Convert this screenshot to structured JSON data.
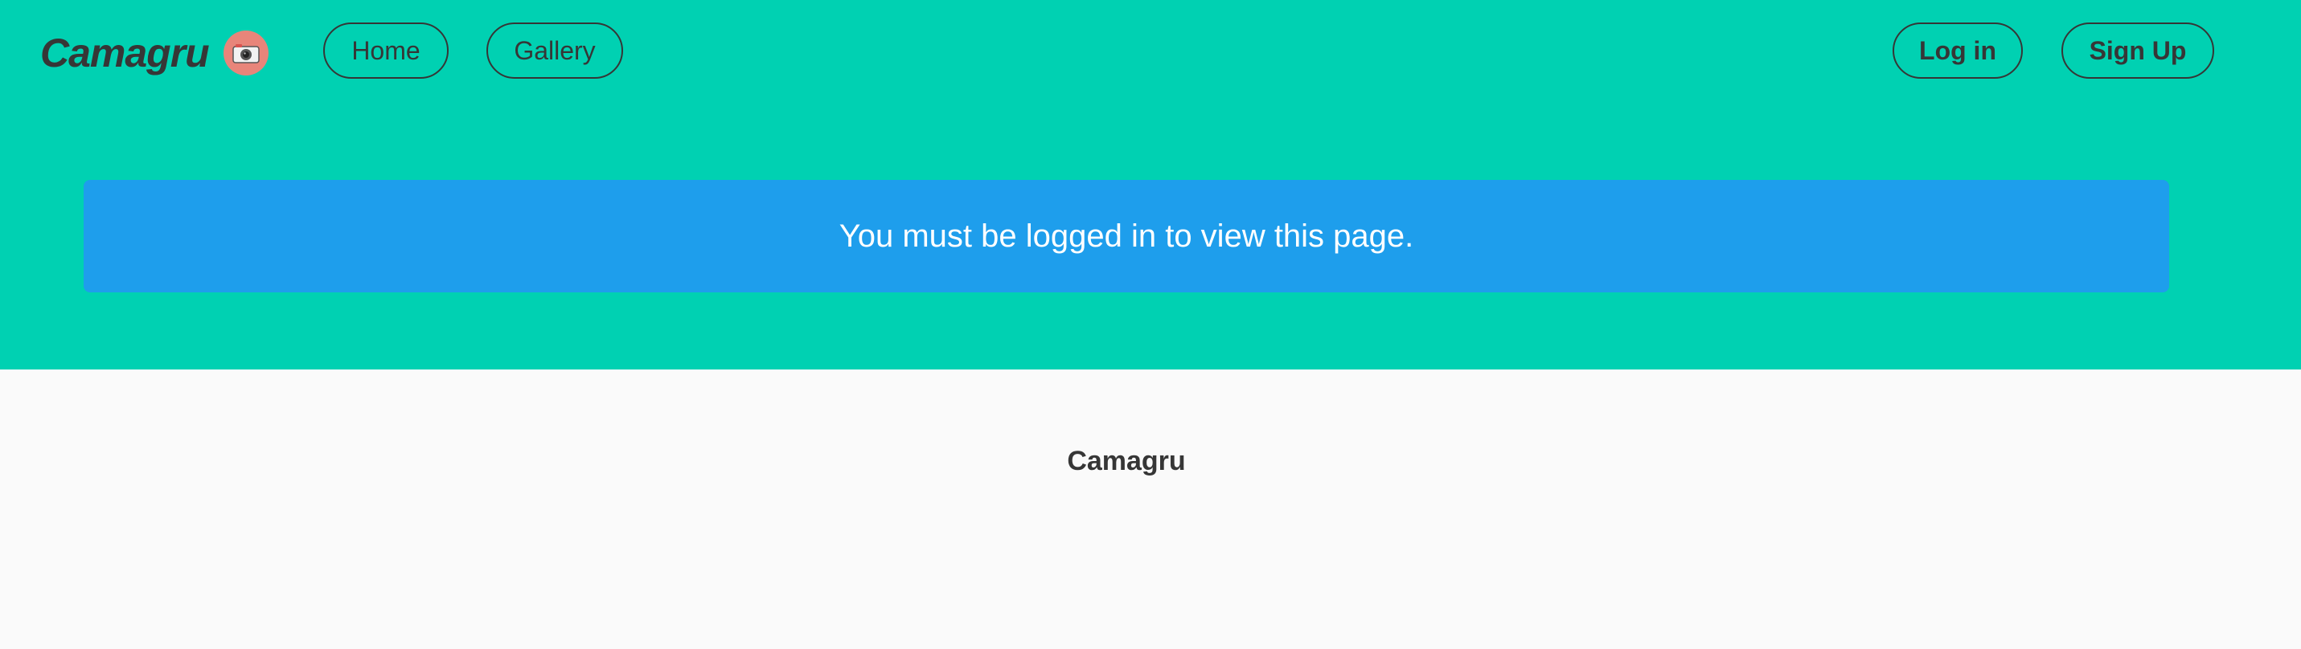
{
  "navbar": {
    "brand": "Camagru",
    "brand_icon": "camera-icon",
    "links": {
      "home": "Home",
      "gallery": "Gallery"
    },
    "auth": {
      "login": "Log in",
      "signup": "Sign Up"
    }
  },
  "notification": {
    "message": "You must be logged in to view this page."
  },
  "footer": {
    "title": "Camagru"
  },
  "colors": {
    "hero_background": "#00d1b2",
    "notification_background": "#1e9eec",
    "footer_background": "#fafafa",
    "text_dark": "#363636",
    "brand_icon_background": "#e8857a"
  }
}
